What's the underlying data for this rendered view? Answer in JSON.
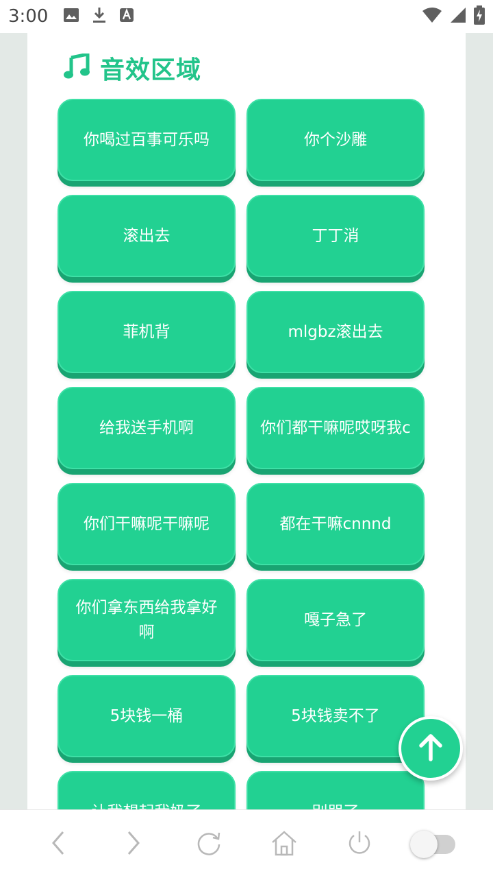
{
  "status_bar": {
    "time": "3:00",
    "icons": [
      "image-icon",
      "download-icon",
      "a-box-icon",
      "wifi-icon",
      "signal-icon",
      "battery-charging-icon"
    ]
  },
  "section": {
    "title": "音效区域",
    "icon": "music-note-icon",
    "accent_color": "#22c48a"
  },
  "sounds": [
    {
      "label": "你喝过百事可乐吗"
    },
    {
      "label": "你个沙雕"
    },
    {
      "label": "滚出去"
    },
    {
      "label": "丁丁消"
    },
    {
      "label": "菲机背"
    },
    {
      "label": "mlgbz滚出去"
    },
    {
      "label": "给我送手机啊"
    },
    {
      "label": "你们都干嘛呢哎呀我c"
    },
    {
      "label": "你们干嘛呢干嘛呢"
    },
    {
      "label": "都在干嘛cnnnd"
    },
    {
      "label": "你们拿东西给我拿好啊"
    },
    {
      "label": "嘎子急了"
    },
    {
      "label": "5块钱一桶"
    },
    {
      "label": "5块钱卖不了"
    },
    {
      "label": "让我想起我奶了"
    },
    {
      "label": "别哭了"
    }
  ],
  "button_color": "#22d192",
  "fab": {
    "icon": "arrow-up-icon"
  },
  "bottom_nav": [
    "back-icon",
    "forward-icon",
    "refresh-icon",
    "home-icon",
    "power-icon",
    "toggle"
  ]
}
